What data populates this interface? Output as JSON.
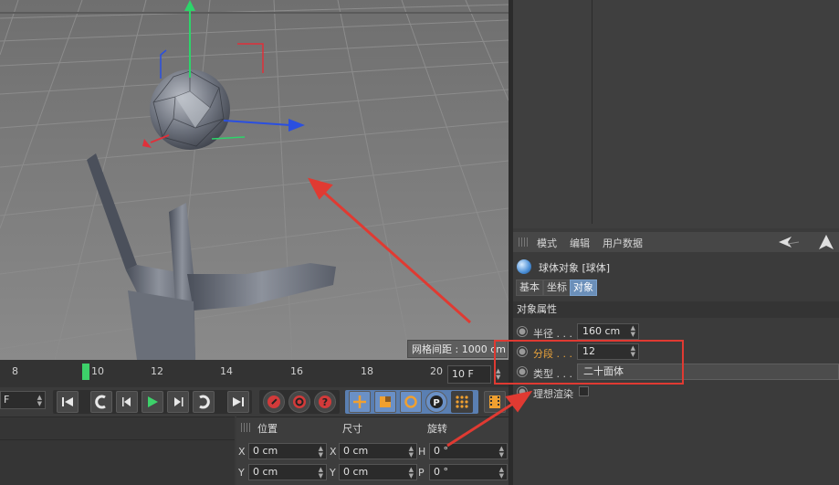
{
  "viewport": {
    "grid_spacing_readout": "网格间距 : 1000 cm"
  },
  "attributes": {
    "menu": [
      "模式",
      "编辑",
      "用户数据"
    ],
    "object_title": "球体对象 [球体]",
    "tabs": [
      "基本",
      "坐标",
      "对象"
    ],
    "active_tab": "对象",
    "section_header": "对象属性",
    "properties": [
      {
        "label": "半径 . . .",
        "value": "160 cm",
        "highlight": false
      },
      {
        "label": "分段 . . .",
        "value": "12",
        "highlight": true
      },
      {
        "label": "类型 . . .",
        "value": "二十面体",
        "highlight": false
      },
      {
        "label": "理想渲染",
        "value": "",
        "highlight": false
      }
    ]
  },
  "timeline": {
    "ticks": [
      "8",
      "10",
      "12",
      "14",
      "16",
      "18",
      "20"
    ],
    "current_frame_tick": "10",
    "end_frame": "10 F"
  },
  "transport": {
    "start_frame": "F"
  },
  "coordinates": {
    "headers": [
      "位置",
      "尺寸",
      "旋转"
    ],
    "rows": [
      {
        "pos_axis": "X",
        "pos": "0 cm",
        "size_axis": "X",
        "size": "0 cm",
        "rot_axis": "H",
        "rot": "0 °"
      },
      {
        "pos_axis": "Y",
        "pos": "0 cm",
        "size_axis": "Y",
        "size": "0 cm",
        "rot_axis": "P",
        "rot": "0 °"
      }
    ]
  },
  "colors": {
    "highlight_label": "#e8a23a",
    "annotation": "#e03a32",
    "playhead": "#3dd16a",
    "active_tab": "#6b8fb9"
  }
}
